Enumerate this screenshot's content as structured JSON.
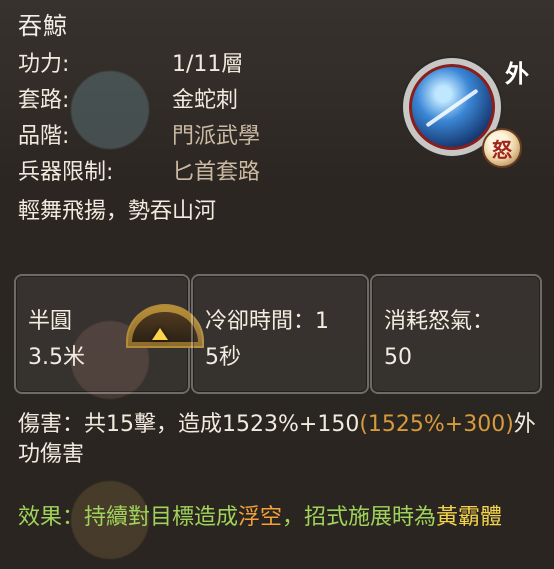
{
  "skill": {
    "name": "吞鯨",
    "power_label": "功力:",
    "power_value": "1/11層",
    "style_label": "套路:",
    "style_value": "金蛇刺",
    "grade_label": "品階:",
    "grade_value": "門派武學",
    "weapon_label": "兵器限制:",
    "weapon_value": "匕首套路",
    "motto": "輕舞飛揚，勢吞山河",
    "badge_outer": "外",
    "badge_rage": "怒"
  },
  "cards": {
    "range_label": "半圓",
    "range_value": "3.5米",
    "cooldown_label": "冷卻時間：1",
    "cooldown_value": "5秒",
    "rage_label": "消耗怒氣：",
    "rage_value": "50"
  },
  "damage": {
    "prefix": "傷害：共15擊，造成1523%+150",
    "highlight": "(1525%+300)",
    "suffix": "外功傷害"
  },
  "effect": {
    "prefix": "效果：持續對目標造成",
    "float": "浮空",
    "middle": "，招式施展時為",
    "hegemon": "黃霸體"
  },
  "colors": {
    "highlight_orange": "#d79a3c",
    "effect_green": "#9fd35a"
  }
}
